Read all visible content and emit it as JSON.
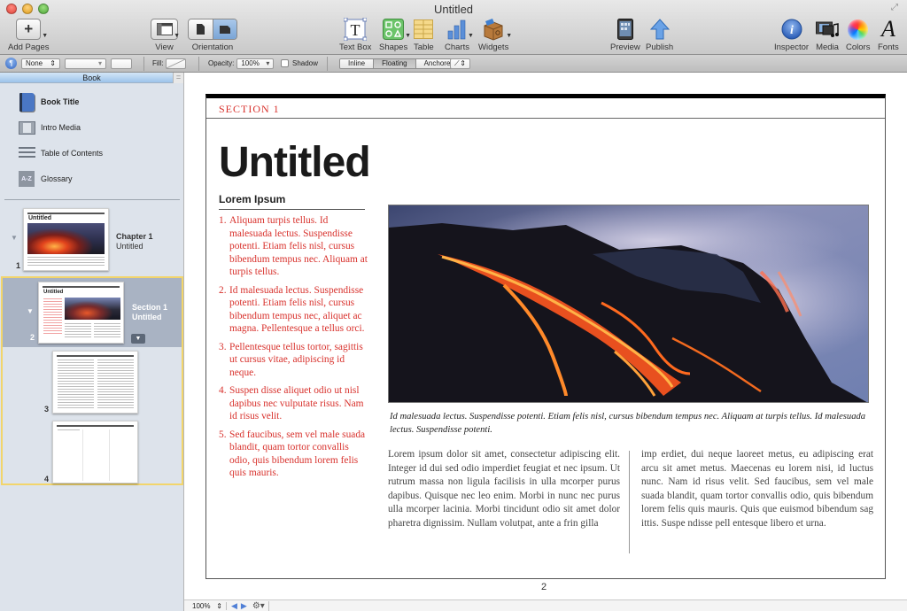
{
  "window": {
    "title": "Untitled"
  },
  "toolbar": {
    "add_pages": "Add Pages",
    "view": "View",
    "orientation": "Orientation",
    "text_box": "Text Box",
    "shapes": "Shapes",
    "table": "Table",
    "charts": "Charts",
    "widgets": "Widgets",
    "preview": "Preview",
    "publish": "Publish",
    "inspector": "Inspector",
    "media": "Media",
    "colors": "Colors",
    "fonts": "Fonts"
  },
  "format_bar": {
    "paragraph_style": "None",
    "fill_label": "Fill:",
    "opacity_label": "Opacity:",
    "opacity_value": "100%",
    "shadow_label": "Shadow",
    "shadow_checked": false,
    "wrap_options": [
      "Inline",
      "Floating",
      "Anchored"
    ],
    "wrap_selected": "Floating"
  },
  "sidebar": {
    "header": "Book",
    "items": [
      {
        "label": "Book Title",
        "icon": "book-icon"
      },
      {
        "label": "Intro Media",
        "icon": "film-icon"
      },
      {
        "label": "Table of Contents",
        "icon": "list-icon"
      },
      {
        "label": "Glossary",
        "icon": "glossary-az-icon",
        "icon_text": "A-Z"
      }
    ],
    "pages": [
      {
        "number": "1",
        "kind": "Chapter 1",
        "title": "Untitled",
        "thumb_title": "Untitled"
      },
      {
        "number": "2",
        "kind": "Section 1",
        "title": "Untitled",
        "thumb_title": "Untitled",
        "selected": true
      },
      {
        "number": "3"
      },
      {
        "number": "4"
      }
    ]
  },
  "document": {
    "section_label": "SECTION 1",
    "title": "Untitled",
    "subhead": "Lorem Ipsum",
    "list": [
      {
        "num": "1.",
        "text": "Aliquam turpis tellus. Id malesuada lectus. Suspendisse potenti. Etiam felis nisl, cursus bibendum tempus nec. Aliquam at turpis tellus."
      },
      {
        "num": "2.",
        "text": "Id malesuada lectus. Suspendisse potenti. Etiam felis nisl, cursus bibendum tempus nec, aliquet ac magna. Pellentesque a tellus orci."
      },
      {
        "num": "3.",
        "text": "Pellentesque tellus tortor, sagittis ut cursus vitae, adipiscing id neque."
      },
      {
        "num": "4.",
        "text": "Suspen disse aliquet odio ut nisl dapibus nec vulputate risus. Nam id risus velit."
      },
      {
        "num": "5.",
        "text": "Sed faucibus, sem vel male suada blandit, quam tortor convallis odio, quis bibendum lorem felis quis mauris."
      }
    ],
    "image_alt": "Lava flowing down a volcanic slope into the sea",
    "caption": "Id malesuada lectus. Suspendisse potenti. Etiam felis nisl, cursus bibendum tempus nec. Aliquam at turpis tellus. Id malesuada lectus. Suspendisse potenti.",
    "body_col1": "Lorem ipsum dolor sit amet, consectetur adipiscing elit. Integer id dui sed odio imperdiet feugiat et nec ipsum. Ut rutrum massa non ligula facilisis in ulla mcorper purus dapibus. Quisque nec leo enim. Morbi in nunc nec purus ulla mcorper lacinia. Morbi tincidunt odio sit amet dolor pharetra dignissim. Nullam volutpat, ante a frin gilla",
    "body_col2": "imp erdiet, dui neque laoreet metus, eu adipiscing erat arcu sit amet metus. Maecenas eu lorem nisi, id luctus nunc. Nam id risus velit. Sed faucibus, sem vel male suada blandit, quam tortor convallis odio, quis bibendum lorem felis quis mauris. Quis que euismod bibendum sag ittis. Suspe ndisse pell entesque libero et urna.",
    "page_number": "2"
  },
  "bottom_bar": {
    "zoom": "100%"
  },
  "colors": {
    "accent_red": "#d8312c",
    "selection_yellow": "#f2d56b",
    "sidebar_bg": "#dde3eb",
    "selected_row": "#a9b3c3"
  }
}
